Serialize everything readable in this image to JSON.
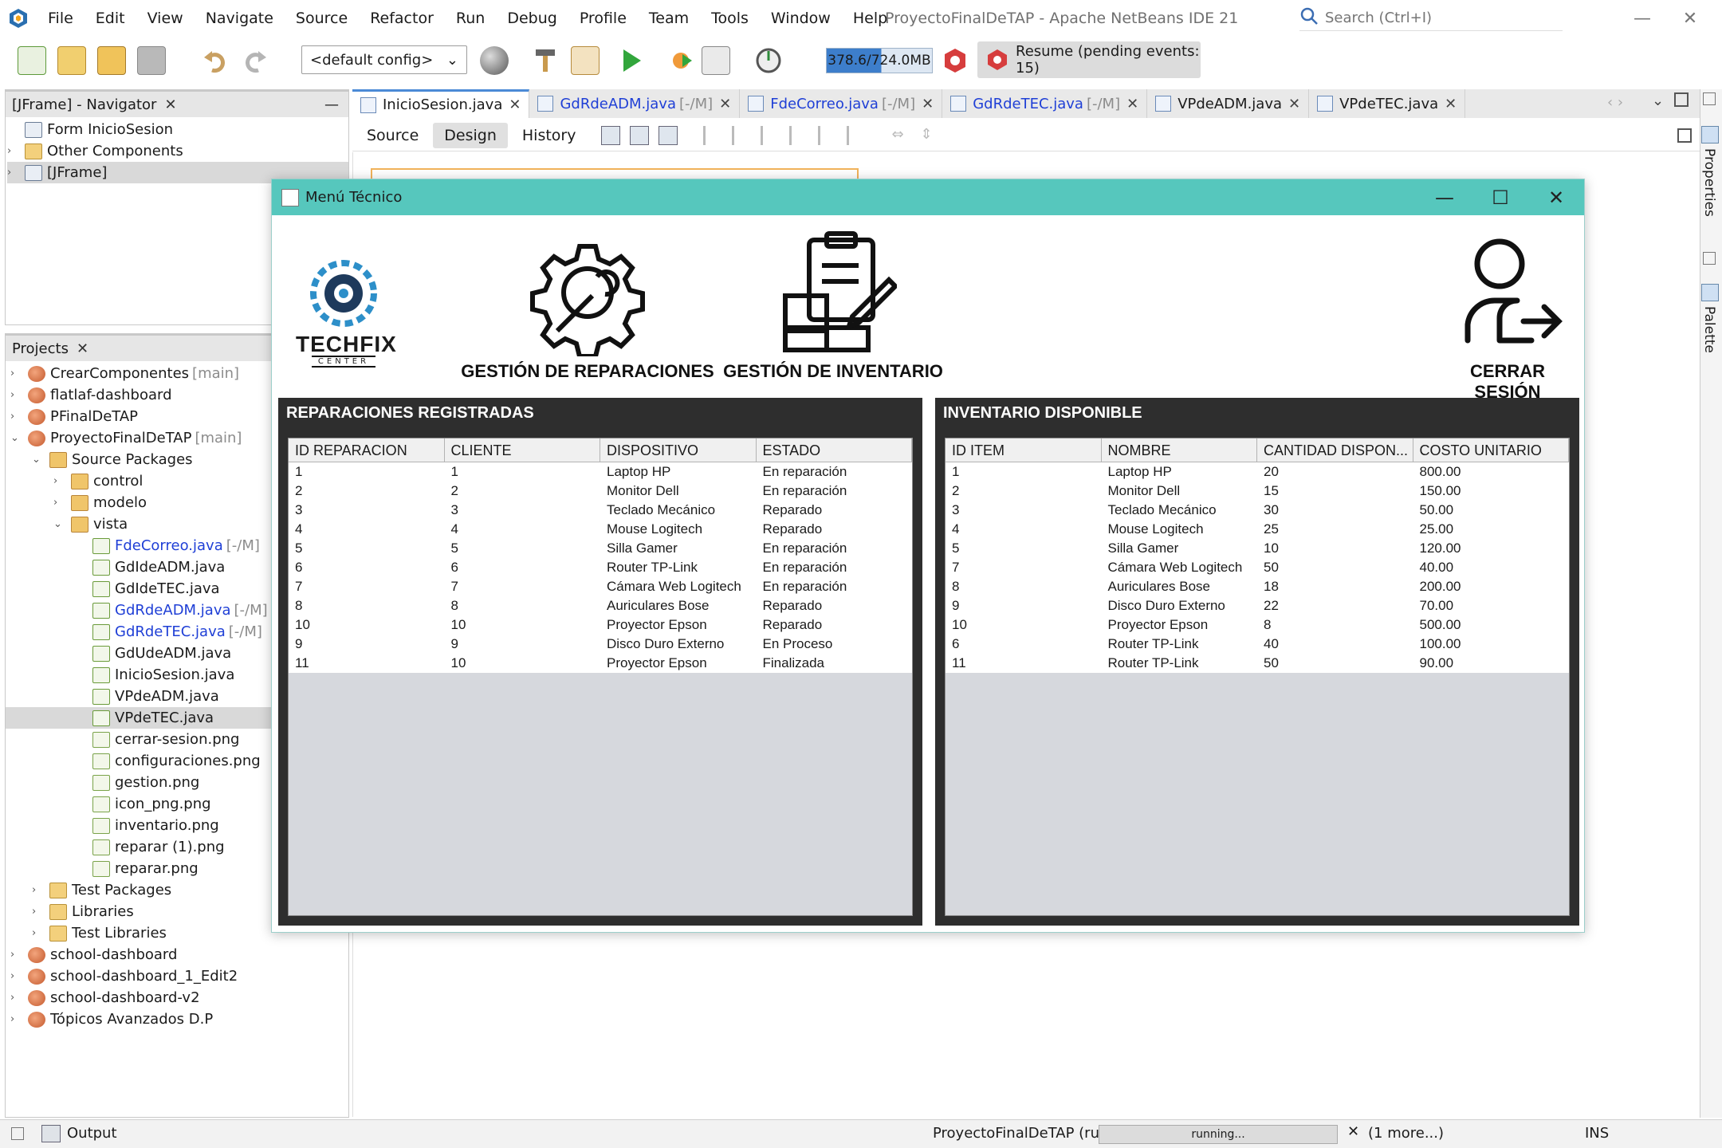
{
  "menubar": {
    "items": [
      "File",
      "Edit",
      "View",
      "Navigate",
      "Source",
      "Refactor",
      "Run",
      "Debug",
      "Profile",
      "Team",
      "Tools",
      "Window",
      "Help"
    ],
    "window_title": "ProyectoFinalDeTAP - Apache NetBeans IDE 21",
    "search_placeholder": "Search (Ctrl+I)"
  },
  "toolbar": {
    "config": "<default config>",
    "memory": "378.6/724.0MB",
    "resume": "Resume (pending events: 15)"
  },
  "navigator": {
    "title": "[JFrame] - Navigator",
    "items": [
      {
        "label": "Form InicioSesion"
      },
      {
        "label": "Other Components"
      },
      {
        "label": "[JFrame]"
      }
    ]
  },
  "projects": {
    "title": "Projects",
    "tree": [
      {
        "label": "CrearComponentes",
        "suffix": "[main]",
        "type": "proj",
        "indent": 0,
        "tw": ">"
      },
      {
        "label": "flatlaf-dashboard",
        "suffix": "",
        "type": "proj",
        "indent": 0,
        "tw": ">"
      },
      {
        "label": "PFinalDeTAP",
        "suffix": "",
        "type": "proj",
        "indent": 0,
        "tw": ">"
      },
      {
        "label": "ProyectoFinalDeTAP",
        "suffix": "[main]",
        "type": "proj",
        "indent": 0,
        "tw": "v"
      },
      {
        "label": "Source Packages",
        "suffix": "",
        "type": "pkg",
        "indent": 1,
        "tw": "v"
      },
      {
        "label": "control",
        "suffix": "",
        "type": "pkg",
        "indent": 2,
        "tw": ">"
      },
      {
        "label": "modelo",
        "suffix": "",
        "type": "pkg",
        "indent": 2,
        "tw": ">"
      },
      {
        "label": "vista",
        "suffix": "",
        "type": "pkg",
        "indent": 2,
        "tw": "v"
      },
      {
        "label": "FdeCorreo.java",
        "suffix": "[-/M]",
        "type": "java",
        "indent": 3,
        "tw": "",
        "modified": true
      },
      {
        "label": "GdIdeADM.java",
        "suffix": "",
        "type": "java",
        "indent": 3,
        "tw": ""
      },
      {
        "label": "GdIdeTEC.java",
        "suffix": "",
        "type": "java",
        "indent": 3,
        "tw": ""
      },
      {
        "label": "GdRdeADM.java",
        "suffix": "[-/M]",
        "type": "java",
        "indent": 3,
        "tw": "",
        "modified": true
      },
      {
        "label": "GdRdeTEC.java",
        "suffix": "[-/M]",
        "type": "java",
        "indent": 3,
        "tw": "",
        "modified": true
      },
      {
        "label": "GdUdeADM.java",
        "suffix": "",
        "type": "java",
        "indent": 3,
        "tw": ""
      },
      {
        "label": "InicioSesion.java",
        "suffix": "",
        "type": "java",
        "indent": 3,
        "tw": ""
      },
      {
        "label": "VPdeADM.java",
        "suffix": "",
        "type": "java",
        "indent": 3,
        "tw": ""
      },
      {
        "label": "VPdeTEC.java",
        "suffix": "",
        "type": "java",
        "indent": 3,
        "tw": "",
        "selected": true
      },
      {
        "label": "cerrar-sesion.png",
        "suffix": "",
        "type": "png",
        "indent": 3,
        "tw": ""
      },
      {
        "label": "configuraciones.png",
        "suffix": "",
        "type": "png",
        "indent": 3,
        "tw": ""
      },
      {
        "label": "gestion.png",
        "suffix": "",
        "type": "png",
        "indent": 3,
        "tw": ""
      },
      {
        "label": "icon_png.png",
        "suffix": "",
        "type": "png",
        "indent": 3,
        "tw": ""
      },
      {
        "label": "inventario.png",
        "suffix": "",
        "type": "png",
        "indent": 3,
        "tw": ""
      },
      {
        "label": "reparar (1).png",
        "suffix": "",
        "type": "png",
        "indent": 3,
        "tw": ""
      },
      {
        "label": "reparar.png",
        "suffix": "",
        "type": "png",
        "indent": 3,
        "tw": ""
      },
      {
        "label": "Test Packages",
        "suffix": "",
        "type": "folder",
        "indent": 1,
        "tw": ">"
      },
      {
        "label": "Libraries",
        "suffix": "",
        "type": "folder",
        "indent": 1,
        "tw": ">"
      },
      {
        "label": "Test Libraries",
        "suffix": "",
        "type": "folder",
        "indent": 1,
        "tw": ">"
      },
      {
        "label": "school-dashboard",
        "suffix": "",
        "type": "proj",
        "indent": 0,
        "tw": ">"
      },
      {
        "label": "school-dashboard_1_Edit2",
        "suffix": "",
        "type": "proj",
        "indent": 0,
        "tw": ">"
      },
      {
        "label": "school-dashboard-v2",
        "suffix": "",
        "type": "proj",
        "indent": 0,
        "tw": ">"
      },
      {
        "label": "Tópicos Avanzados D.P",
        "suffix": "",
        "type": "proj",
        "indent": 0,
        "tw": ">"
      }
    ]
  },
  "editor_tabs": [
    {
      "label": "InicioSesion.java",
      "suffix": "",
      "active": true,
      "modified": false
    },
    {
      "label": "GdRdeADM.java",
      "suffix": "[-/M]",
      "active": false,
      "modified": true
    },
    {
      "label": "FdeCorreo.java",
      "suffix": "[-/M]",
      "active": false,
      "modified": true
    },
    {
      "label": "GdRdeTEC.java",
      "suffix": "[-/M]",
      "active": false,
      "modified": true
    },
    {
      "label": "VPdeADM.java",
      "suffix": "",
      "active": false,
      "modified": false
    },
    {
      "label": "VPdeTEC.java",
      "suffix": "",
      "active": false,
      "modified": false
    }
  ],
  "view_switch": {
    "source": "Source",
    "design": "Design",
    "history": "History"
  },
  "right_strip": {
    "properties": "Properties",
    "palette": "Palette"
  },
  "statusbar": {
    "output": "Output",
    "run_label": "ProyectoFinalDeTAP (run)",
    "progress": "running...",
    "more": "(1 more...)",
    "mode": "INS"
  },
  "jframe": {
    "title": "Menú Técnico",
    "logo_text": "TECHFIX",
    "logo_sub": "CENTER",
    "tiles": {
      "repairs": "GESTIÓN DE REPARACIONES",
      "inventory": "GESTIÓN DE INVENTARIO",
      "logout": "CERRAR SESIÓN"
    },
    "repairs_panel": {
      "title": "REPARACIONES REGISTRADAS",
      "columns": [
        "ID REPARACION",
        "CLIENTE",
        "DISPOSITIVO",
        "ESTADO"
      ],
      "rows": [
        [
          "1",
          "1",
          "Laptop HP",
          "En reparación"
        ],
        [
          "2",
          "2",
          "Monitor Dell",
          "En reparación"
        ],
        [
          "3",
          "3",
          "Teclado Mecánico",
          "Reparado"
        ],
        [
          "4",
          "4",
          "Mouse Logitech",
          "Reparado"
        ],
        [
          "5",
          "5",
          "Silla Gamer",
          "En reparación"
        ],
        [
          "6",
          "6",
          "Router TP-Link",
          "En reparación"
        ],
        [
          "7",
          "7",
          "Cámara Web Logitech",
          "En reparación"
        ],
        [
          "8",
          "8",
          "Auriculares Bose",
          "Reparado"
        ],
        [
          "10",
          "10",
          "Proyector Epson",
          "Reparado"
        ],
        [
          "9",
          "9",
          "Disco Duro Externo",
          "En Proceso"
        ],
        [
          "11",
          "10",
          "Proyector Epson",
          "Finalizada"
        ]
      ]
    },
    "inventory_panel": {
      "title": "INVENTARIO DISPONIBLE",
      "columns": [
        "ID ITEM",
        "NOMBRE",
        "CANTIDAD DISPON...",
        "COSTO UNITARIO"
      ],
      "rows": [
        [
          "1",
          "Laptop HP",
          "20",
          "800.00"
        ],
        [
          "2",
          "Monitor Dell",
          "15",
          "150.00"
        ],
        [
          "3",
          "Teclado Mecánico",
          "30",
          "50.00"
        ],
        [
          "4",
          "Mouse Logitech",
          "25",
          "25.00"
        ],
        [
          "5",
          "Silla Gamer",
          "10",
          "120.00"
        ],
        [
          "7",
          "Cámara Web Logitech",
          "50",
          "40.00"
        ],
        [
          "8",
          "Auriculares Bose",
          "18",
          "200.00"
        ],
        [
          "9",
          "Disco Duro Externo",
          "22",
          "70.00"
        ],
        [
          "10",
          "Proyector Epson",
          "8",
          "500.00"
        ],
        [
          "6",
          "Router TP-Link",
          "40",
          "100.00"
        ],
        [
          "11",
          "Router TP-Link",
          "50",
          "90.00"
        ]
      ]
    }
  }
}
